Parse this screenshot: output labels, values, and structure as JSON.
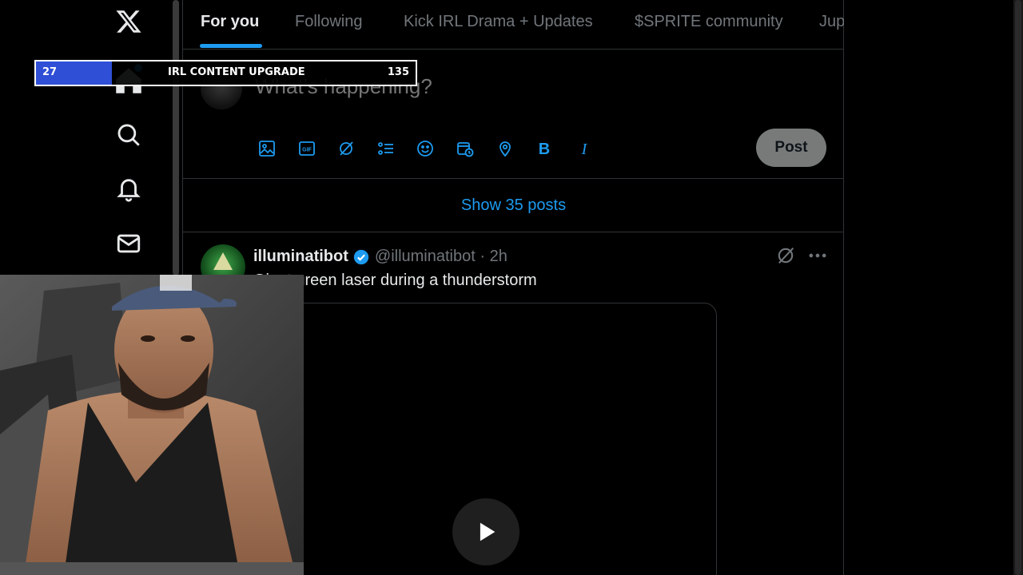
{
  "nav": {
    "logo_icon": "x-logo-icon",
    "items": [
      "home-icon",
      "search-icon",
      "bell-icon",
      "mail-icon"
    ]
  },
  "tabs": [
    {
      "label": "For you",
      "active": true
    },
    {
      "label": "Following",
      "active": false
    },
    {
      "label": "Kick IRL Drama + Updates",
      "active": false
    },
    {
      "label": "$SPRITE community",
      "active": false
    },
    {
      "label": "Jup",
      "active": false
    }
  ],
  "composer": {
    "placeholder": "What's happening?",
    "tools": [
      "image-icon",
      "gif-icon",
      "grok-icon",
      "poll-icon",
      "emoji-icon",
      "schedule-icon",
      "location-icon",
      "bold-icon",
      "italic-icon"
    ],
    "post_label": "Post"
  },
  "feed": {
    "show_posts_label": "Show 35 posts"
  },
  "tweet": {
    "name": "illuminatibot",
    "handle_time": "@illuminatibot · 2h",
    "text": "Giant green laser during a thunderstorm"
  },
  "overlay": {
    "left_value": "27",
    "title": "IRL CONTENT UPGRADE",
    "right_value": "135",
    "progress": 0.2
  },
  "colors": {
    "accent": "#1d9bf0",
    "background": "#000000",
    "muted": "#71767b",
    "progress_fill": "#2f4fd6"
  }
}
